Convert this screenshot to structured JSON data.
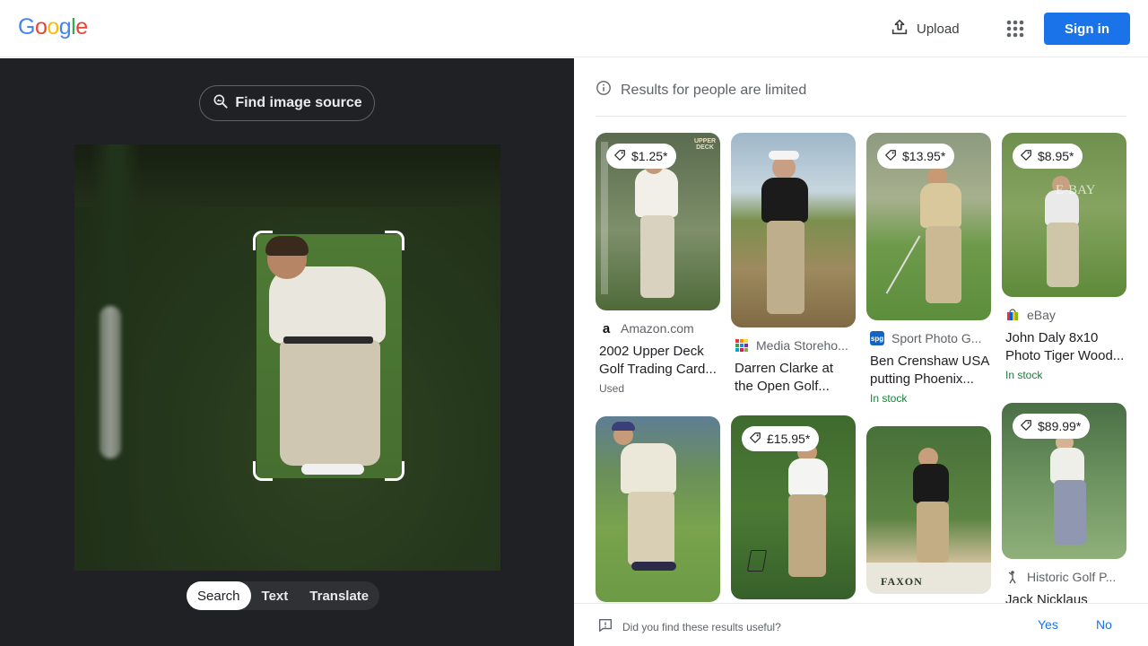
{
  "header": {
    "logo": {
      "G": "G",
      "o1": "o",
      "o2": "o",
      "g": "g",
      "l": "l",
      "e": "e"
    },
    "upload_label": "Upload",
    "apps_icon": "apps-grid-icon",
    "signin_label": "Sign in",
    "colors": {
      "blue": "#4285f4",
      "red": "#ea4335",
      "yellow": "#fbbc05",
      "green": "#34a853",
      "accent": "#1a73e8"
    }
  },
  "left": {
    "find_source_label": "Find image source",
    "modes": [
      {
        "label": "Search",
        "active": true
      },
      {
        "label": "Text",
        "active": false
      },
      {
        "label": "Translate",
        "active": false
      }
    ]
  },
  "right": {
    "notice": "Results for people are limited",
    "results": [
      {
        "price": "$1.25*",
        "source": "Amazon.com",
        "favicon": "a",
        "title": "2002 Upper Deck Golf Trading Card...",
        "meta": "Used",
        "meta_green": false
      },
      {
        "price": "",
        "source": "Media Storeho...",
        "favicon": "grid",
        "title": "Darren Clarke at the Open Golf...",
        "meta": "",
        "meta_green": false
      },
      {
        "price": "$13.95*",
        "source": "Sport Photo G...",
        "favicon": "spg",
        "title": "Ben Crenshaw USA putting Phoenix...",
        "meta": "In stock",
        "meta_green": true
      },
      {
        "price": "$8.95*",
        "source": "eBay",
        "favicon": "ebay",
        "title": "John Daly 8x10 Photo Tiger Wood...",
        "meta": "In stock",
        "meta_green": true
      },
      {
        "price": "",
        "source": "",
        "favicon": "",
        "title": "",
        "meta": "",
        "meta_green": false
      },
      {
        "price": "£15.95*",
        "source": "",
        "favicon": "",
        "title": "",
        "meta": "",
        "meta_green": false
      },
      {
        "price": "",
        "source": "",
        "favicon": "",
        "title": "",
        "meta": "",
        "meta_green": false
      },
      {
        "price": "$89.99*",
        "source": "Historic Golf P...",
        "favicon": "golfer",
        "title": "Jack Nicklaus",
        "meta": "",
        "meta_green": false
      }
    ],
    "thumb_texts": {
      "card1_brand": "UPPER DECK",
      "card4_watermark": "E-BAY",
      "card7_name": "FAXON"
    }
  },
  "feedback": {
    "question": "Did you find these results useful?",
    "yes": "Yes",
    "no": "No"
  }
}
